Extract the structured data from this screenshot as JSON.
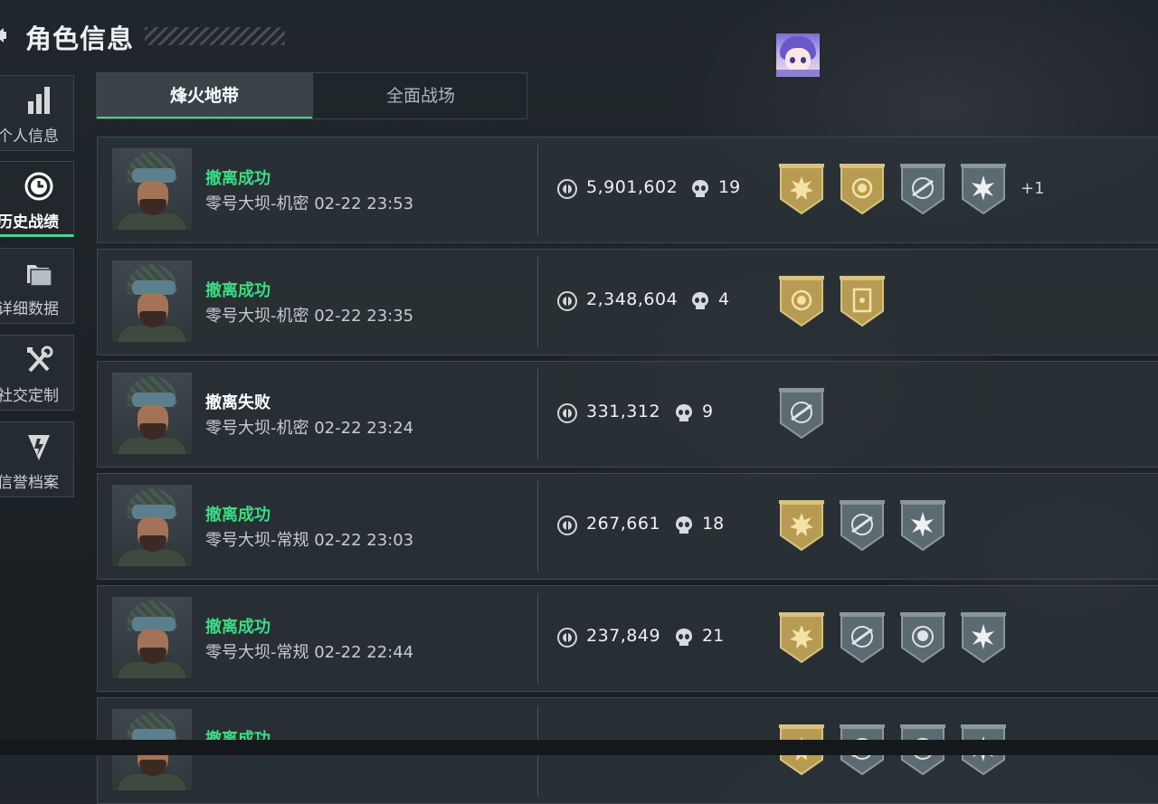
{
  "header": {
    "title": "角色信息"
  },
  "sidebar": {
    "items": [
      {
        "label": "个人信息",
        "icon": "bar-chart-icon",
        "active": false
      },
      {
        "label": "历史战绩",
        "icon": "history-clock-icon",
        "active": true
      },
      {
        "label": "详细数据",
        "icon": "folder-icon",
        "active": false
      },
      {
        "label": "社交定制",
        "icon": "tools-icon",
        "active": false
      },
      {
        "label": "信誉档案",
        "icon": "shield-badge-icon",
        "active": false
      }
    ]
  },
  "tabs": [
    {
      "label": "烽火地带",
      "active": true
    },
    {
      "label": "全面战场",
      "active": false
    }
  ],
  "colors": {
    "success": "#3ddc84",
    "gold_medal": "#b89b52",
    "silver_medal": "#5c6a72",
    "accent": "#4fd18a"
  },
  "matches": [
    {
      "status": "撤离成功",
      "status_type": "success",
      "map": "零号大坝-机密",
      "time": "02-22 23:53",
      "value": "5,901,602",
      "kills": "19",
      "medals": [
        "gold-sun-medal",
        "gold-coin-medal",
        "silver-rifle-medal",
        "silver-burst-medal"
      ],
      "extra": "+1"
    },
    {
      "status": "撤离成功",
      "status_type": "success",
      "map": "零号大坝-机密",
      "time": "02-22 23:35",
      "value": "2,348,604",
      "kills": "4",
      "medals": [
        "gold-coin-medal",
        "gold-card-medal"
      ],
      "extra": ""
    },
    {
      "status": "撤离失败",
      "status_type": "fail",
      "map": "零号大坝-机密",
      "time": "02-22 23:24",
      "value": "331,312",
      "kills": "9",
      "medals": [
        "silver-rifle-medal"
      ],
      "extra": ""
    },
    {
      "status": "撤离成功",
      "status_type": "success",
      "map": "零号大坝-常规",
      "time": "02-22 23:03",
      "value": "267,661",
      "kills": "18",
      "medals": [
        "gold-sun-medal",
        "silver-rifle-medal",
        "silver-burst-medal"
      ],
      "extra": ""
    },
    {
      "status": "撤离成功",
      "status_type": "success",
      "map": "零号大坝-常规",
      "time": "02-22 22:44",
      "value": "237,849",
      "kills": "21",
      "medals": [
        "gold-sun-medal",
        "silver-rifle-medal",
        "silver-skull-medal",
        "silver-burst-medal"
      ],
      "extra": ""
    },
    {
      "status": "撤离成功",
      "status_type": "success",
      "map": "",
      "time": "",
      "value": "",
      "kills": "",
      "medals": [
        "gold-sun-medal",
        "silver-rifle-medal",
        "silver-skull-medal",
        "silver-burst-medal"
      ],
      "extra": ""
    }
  ]
}
